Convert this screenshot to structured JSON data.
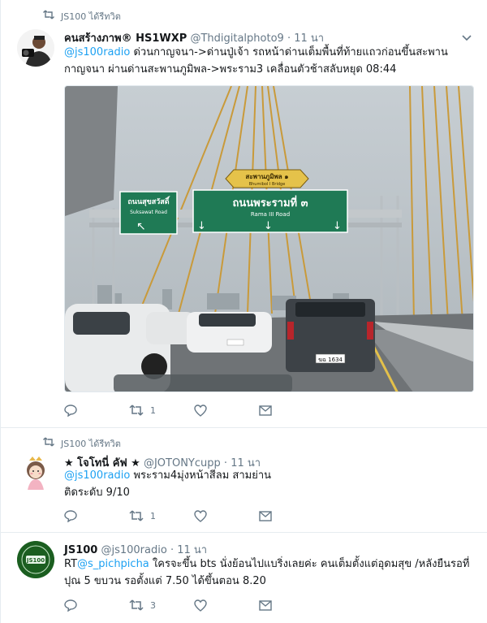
{
  "tweets": [
    {
      "retweet_context": "JS100 ได้รีทวิต",
      "name": "คนสร้างภาพ® HS1WXP",
      "handle": "@Thdigitalphoto9",
      "time": "11 นา",
      "mention": "@js100radio",
      "text_line1": " ด่วนกาญจนา->ด่านปู่เจ้า รถหน้าด่านเต็มพื้นที่ท้ายแถวก่อนขึ้นสะพาน",
      "text_line2": "กาญจนา ผ่านด่านสะพานภูมิพล->พระราม3 เคลื่อนตัวช้าสลับหยุด 08:44",
      "photo": {
        "sign_left_th": "ถนนสุขสวัสดิ์",
        "sign_left_en": "Suksawat Road",
        "sign_main_th": "ถนนพระรามที่ ๓",
        "sign_main_en": "Rama III Road",
        "sign_top_th": "สะพานภูมิพล ๑",
        "sign_top_en": "Bhumibol I Bridge",
        "plate": "ฆฉ 1634"
      },
      "retweets": "1",
      "likes": ""
    },
    {
      "retweet_context": "JS100 ได้รีทวิต",
      "name": "★ โจโทนี่ คัฟ ★",
      "handle": "@JOTONYcupp",
      "time": "11 นา",
      "mention": "@js100radio",
      "text_line1": " พระราม4มุ่งหน้าสีลม สามย่าน",
      "text_line2": "ติดระดับ 9/10",
      "retweets": "1",
      "likes": ""
    },
    {
      "name": "JS100",
      "handle": "@js100radio",
      "time": "11 นา",
      "rt_prefix": "RT",
      "mention": "@s_pichpicha",
      "text_line1": " ใครจะขึ้น bts นั่งย้อนไปแบริ่งเลยค่ะ คนเต็มตั้งแต่อุดมสุข /หลังยืนรอที่",
      "text_line2": "ปุณ 5 ขบวน รอตั้งแต่ 7.50 ได้ขึ้นตอน 8.20",
      "avatar_text": "JS100",
      "retweets": "3",
      "likes": ""
    }
  ],
  "colors": {
    "link": "#1da1f2",
    "meta": "#657786",
    "border": "#e6ecf0"
  },
  "icons": [
    "retweet-icon",
    "caret-down-icon",
    "reply-icon",
    "like-icon",
    "dm-icon"
  ]
}
